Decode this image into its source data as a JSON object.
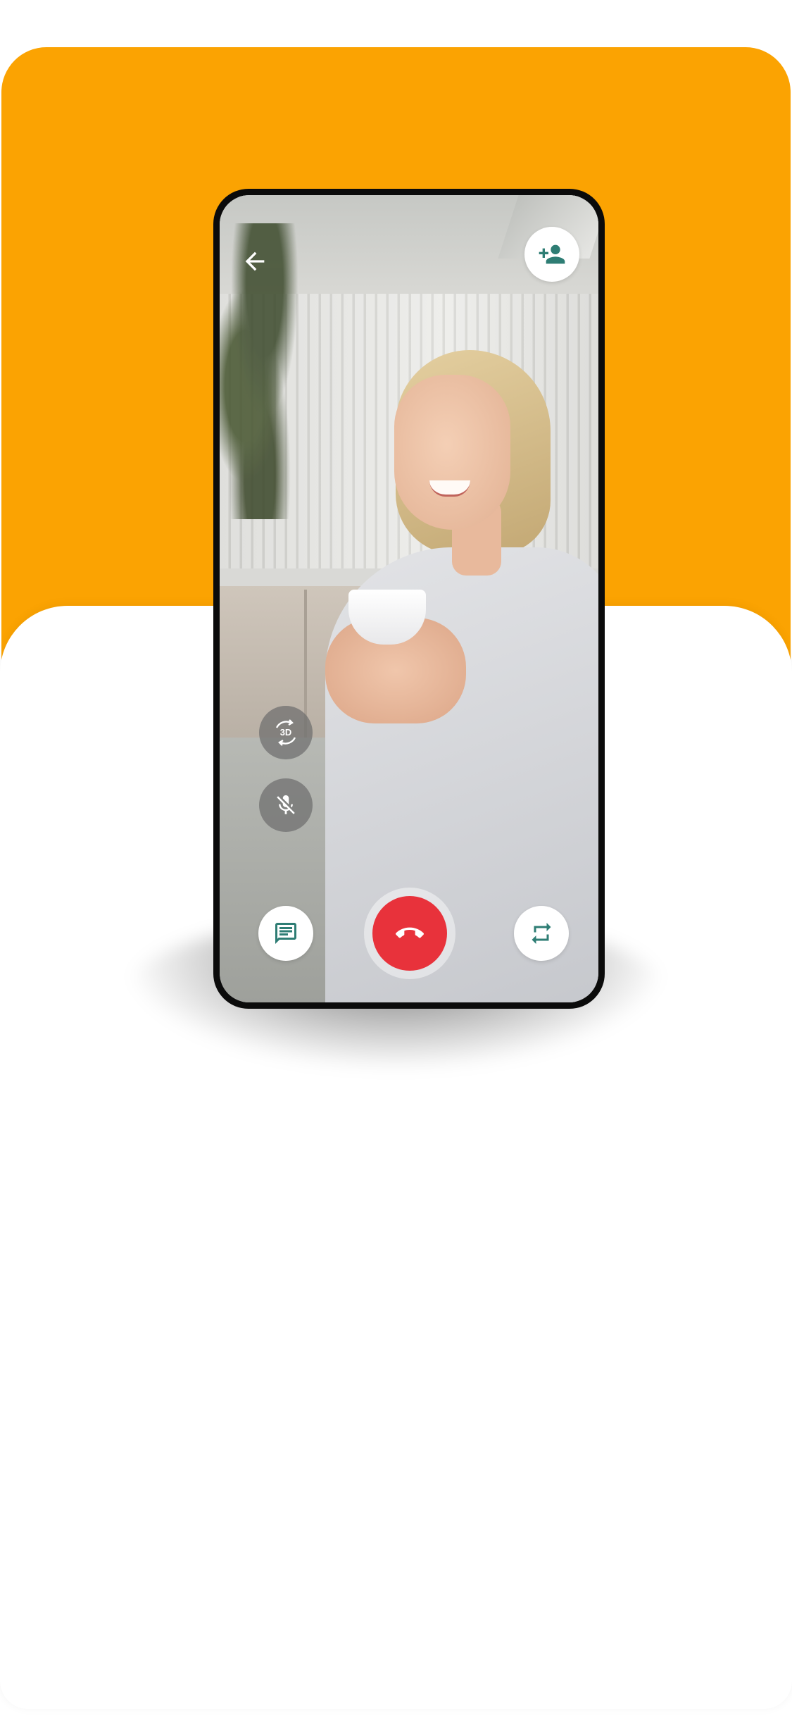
{
  "colors": {
    "accent_orange": "#FBA302",
    "end_call_red": "#E8323B",
    "icon_teal": "#2E7D74",
    "background": "#FFFFFF"
  },
  "call_screen": {
    "back_icon": "arrow-left-icon",
    "add_participant_icon": "person-add-icon",
    "rotate_3d": {
      "icon": "3d-rotation-icon",
      "label": "3D"
    },
    "mute_icon": "mic-off-icon",
    "chat_icon": "chat-icon",
    "end_call_icon": "call-end-icon",
    "switch_camera_icon": "swap-icon"
  }
}
